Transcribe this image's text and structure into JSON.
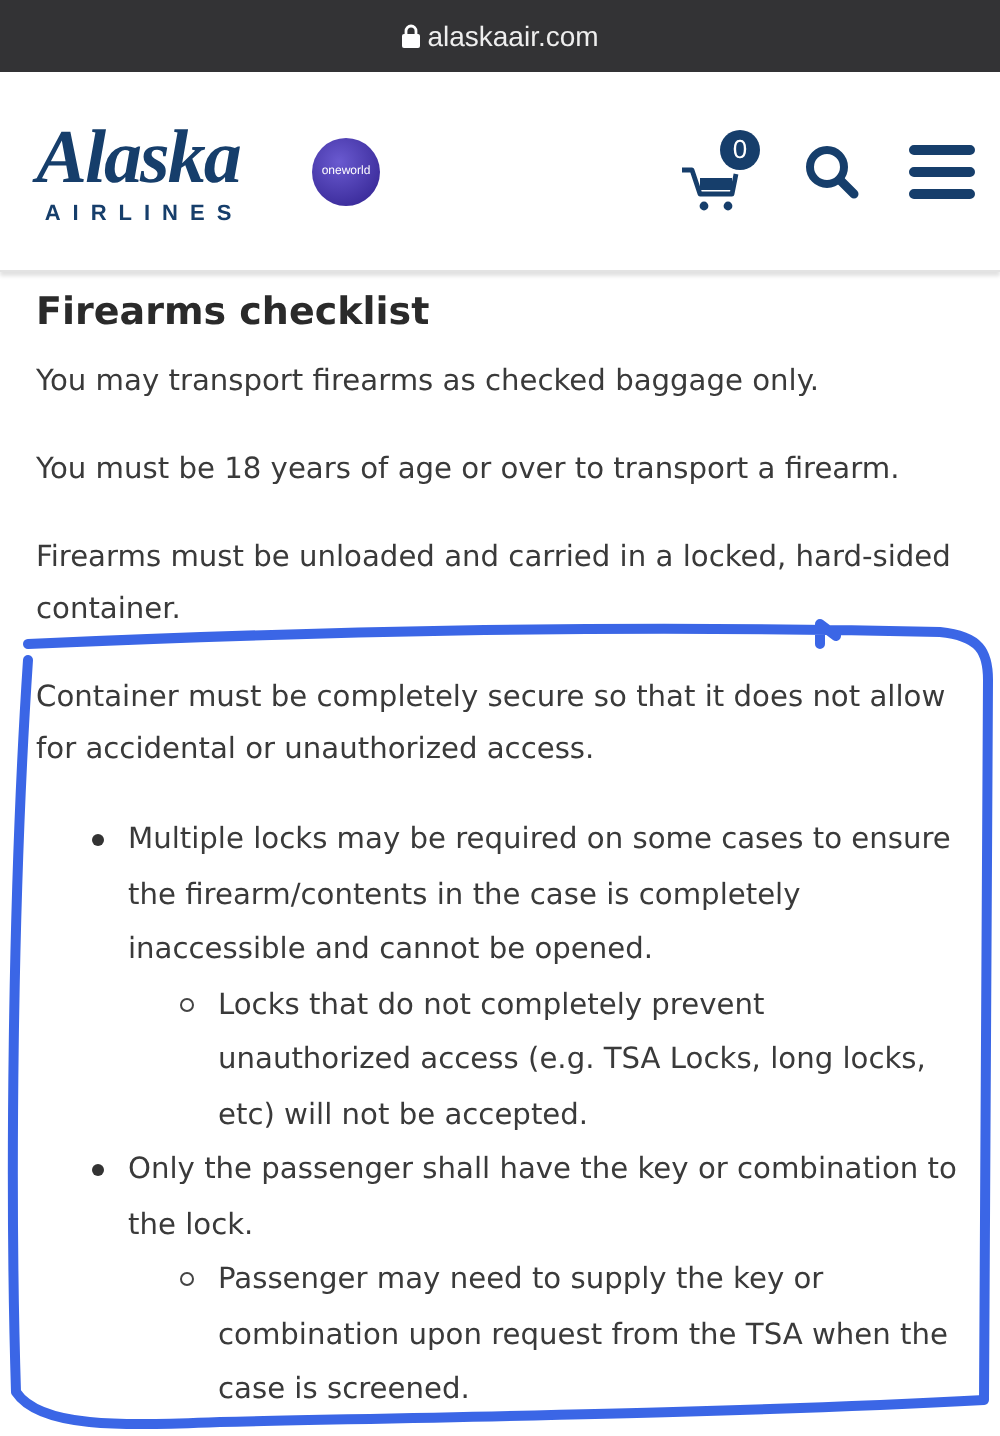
{
  "browser": {
    "url": "alaskaair.com"
  },
  "header": {
    "logo": {
      "wordmark": "Alaska",
      "tagline": "AIRLINES"
    },
    "alliance_badge": "oneworld",
    "cart_count": "0"
  },
  "content": {
    "title": "Firearms checklist",
    "blocks": [
      {
        "kind": "paragraph",
        "text": "You may transport firearms as checked baggage only."
      },
      {
        "kind": "paragraph",
        "text": "You must be 18 years of age or over to transport a firearm."
      },
      {
        "kind": "paragraph",
        "text": "Firearms must be unloaded and carried in a locked, hard-sided container."
      },
      {
        "kind": "paragraph",
        "text": "Container must be completely secure so that it does not allow for accidental or unauthorized access."
      },
      {
        "kind": "list",
        "items": [
          {
            "text": "Multiple locks may be required on some cases to ensure the firearm/contents in the case is completely inaccessible and cannot be opened.",
            "children": [
              {
                "text": "Locks that do not completely prevent unauthorized access (e.g. TSA Locks, long locks, etc) will not be accepted."
              }
            ]
          },
          {
            "text": "Only the passenger shall have the key or combination to the lock.",
            "children": [
              {
                "text": "Passenger may need to supply the key or combination upon request from the TSA when the case is screened."
              }
            ]
          }
        ]
      }
    ]
  }
}
